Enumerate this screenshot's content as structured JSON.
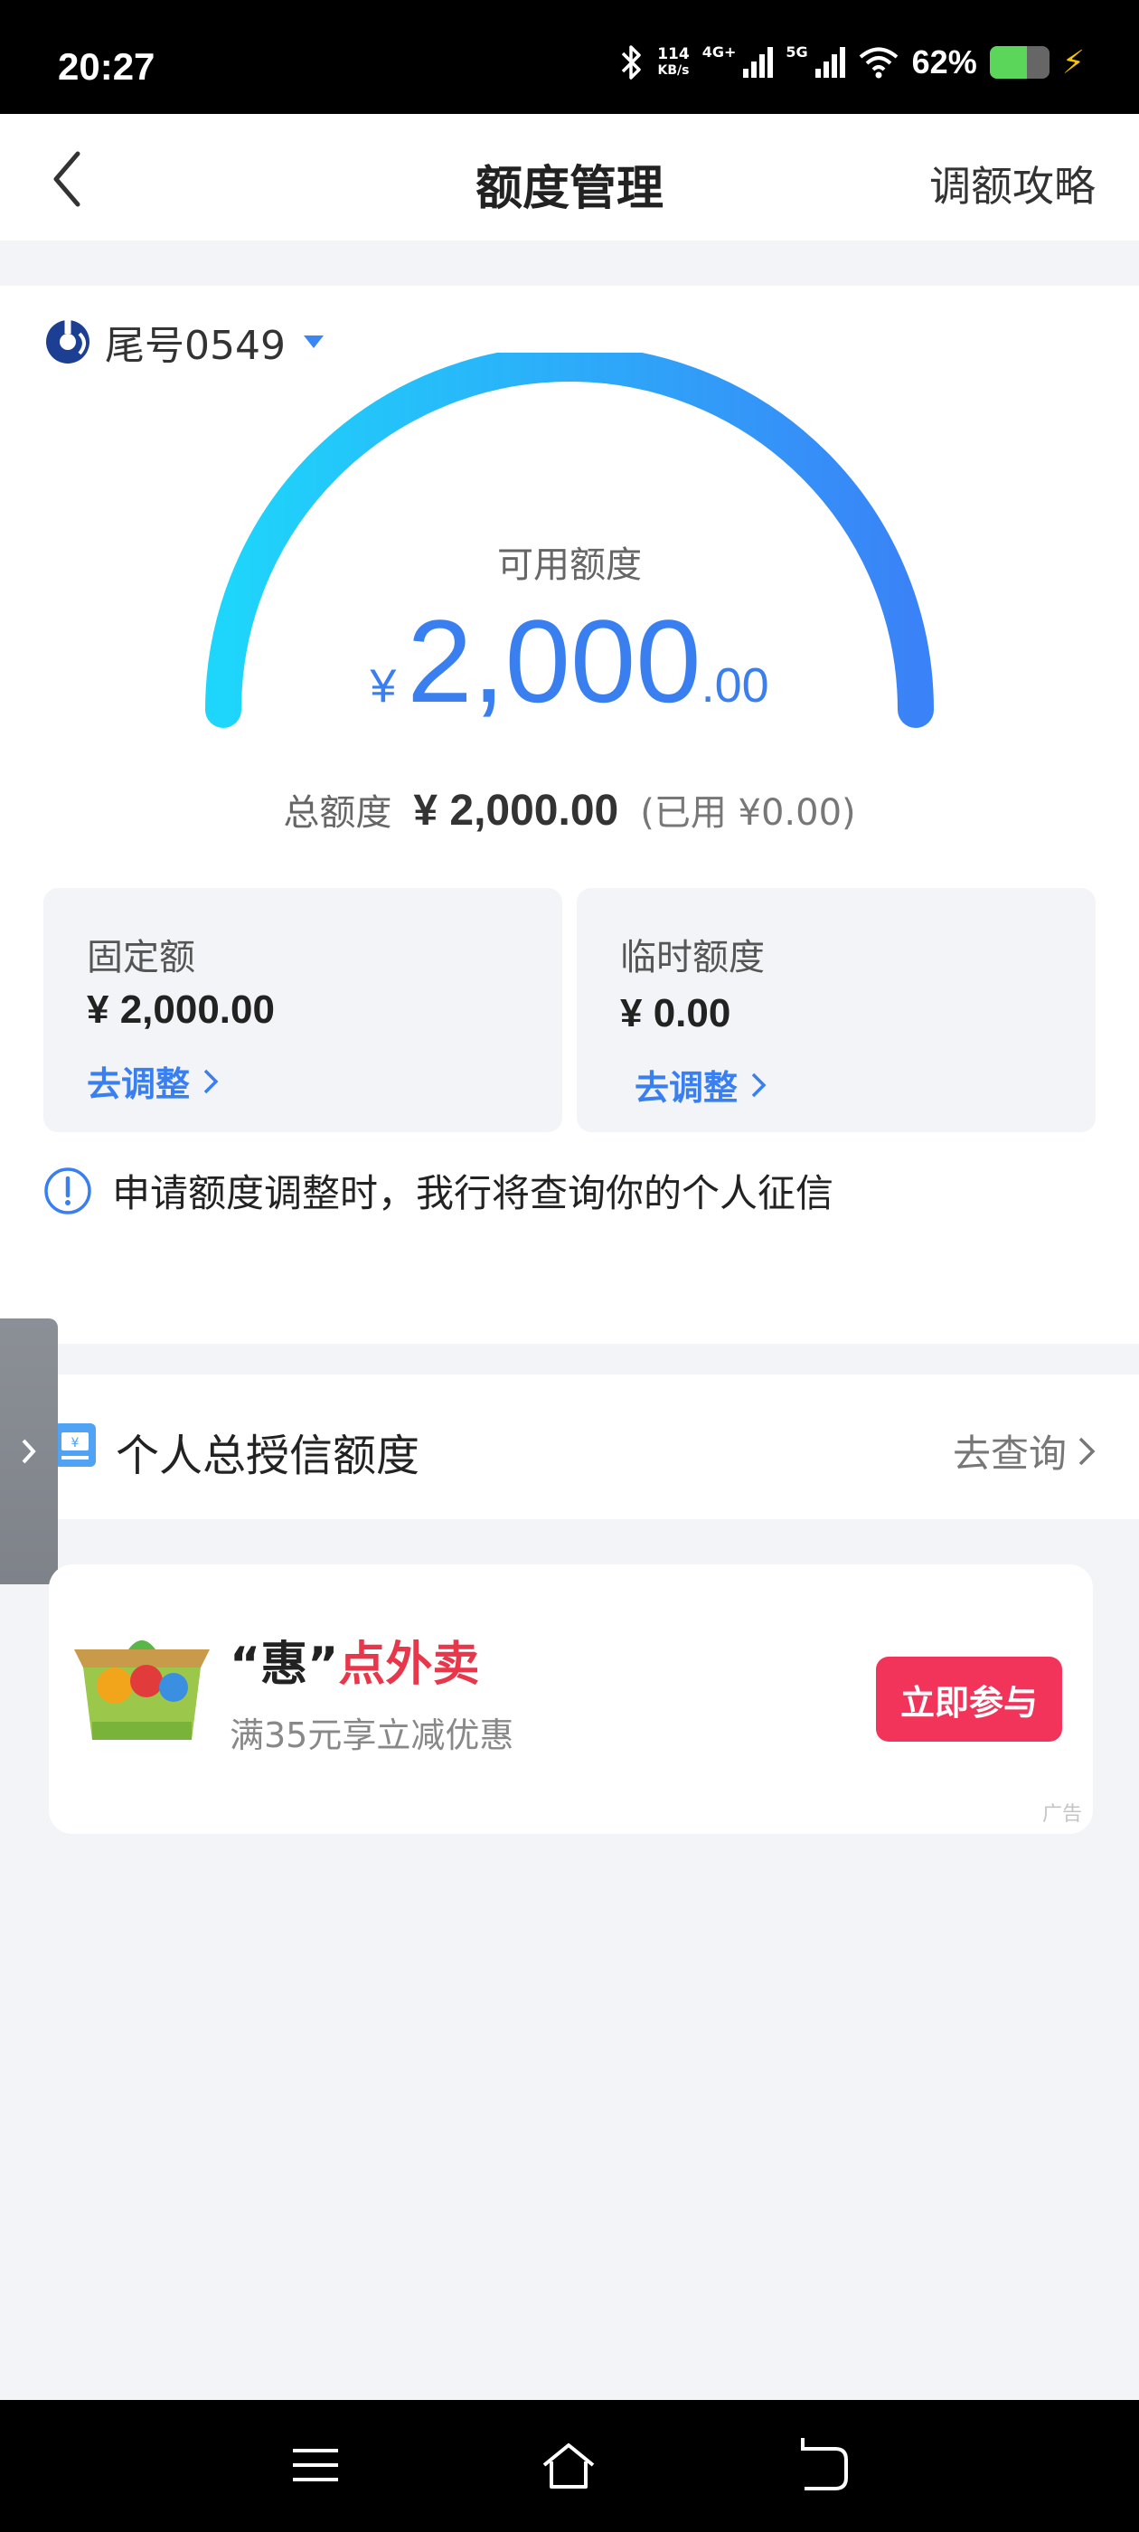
{
  "status_bar": {
    "time": "20:27",
    "net_speed": "114",
    "net_unit": "KB/s",
    "net_4g": "4G+",
    "net_5g": "5G",
    "battery_pct": "62%",
    "battery_level": 0.62
  },
  "header": {
    "title": "额度管理",
    "link": "调额攻略"
  },
  "card": {
    "label": "尾号0549"
  },
  "gauge": {
    "available_label": "可用额度",
    "currency": "¥",
    "available_int": "2,000",
    "available_dec": ".00",
    "usage_fraction": 0.0,
    "colors": [
      "#1ed6fb",
      "#3a82f7"
    ]
  },
  "total": {
    "label": "总额度",
    "amount": "¥ 2,000.00",
    "used": "(已用 ¥0.00)"
  },
  "fixed": {
    "label": "固定额",
    "amount": "¥ 2,000.00",
    "adjust": "去调整"
  },
  "temporary": {
    "label": "临时额度",
    "amount": "¥ 0.00",
    "adjust": "去调整"
  },
  "notice": "申请额度调整时，我行将查询你的个人征信",
  "credit": {
    "title": "个人总授信额度",
    "link": "去查询"
  },
  "ad": {
    "title_quote": "“惠”",
    "title_highlight": "点外卖",
    "subtitle": "满35元享立减优惠",
    "button": "立即参与",
    "tag": "广告",
    "accent": "#f2345a"
  }
}
